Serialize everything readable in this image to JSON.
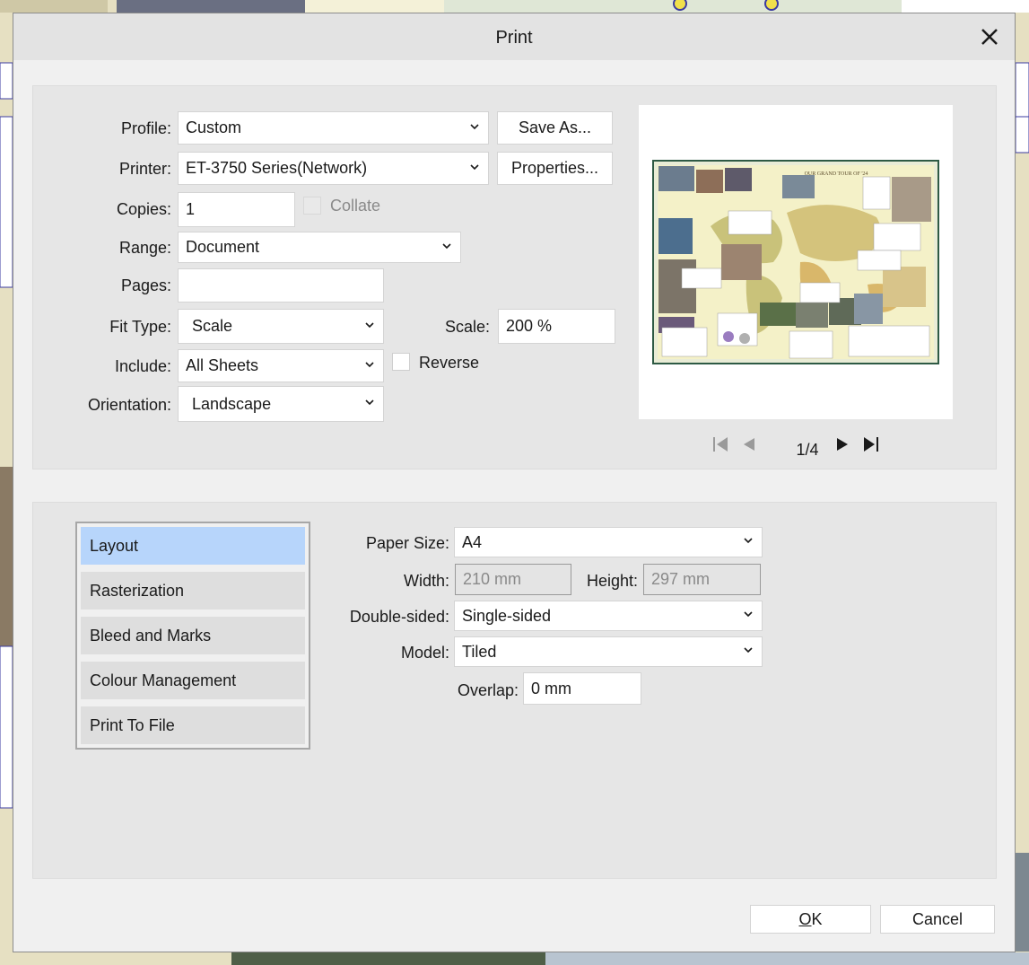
{
  "dialog": {
    "title": "Print"
  },
  "print": {
    "profile": {
      "label": "Profile:",
      "value": "Custom"
    },
    "save_as_label": "Save As...",
    "printer": {
      "label": "Printer:",
      "value": "ET-3750 Series(Network)"
    },
    "properties_label": "Properties...",
    "copies": {
      "label": "Copies:",
      "value": "1"
    },
    "collate": {
      "label": "Collate",
      "checked": false,
      "enabled": false
    },
    "range": {
      "label": "Range:",
      "value": "Document"
    },
    "pages": {
      "label": "Pages:",
      "value": ""
    },
    "fit_type": {
      "label": "Fit Type:",
      "value": "Scale"
    },
    "scale": {
      "label": "Scale:",
      "value": "200 %"
    },
    "include": {
      "label": "Include:",
      "value": "All Sheets"
    },
    "reverse": {
      "label": "Reverse",
      "checked": false
    },
    "orientation": {
      "label": "Orientation:",
      "value": "Landscape"
    }
  },
  "preview": {
    "poster_title": "OUR GRAND TOUR OF '24",
    "page_indicator": "1/4"
  },
  "tabs": [
    {
      "label": "Layout",
      "active": true
    },
    {
      "label": "Rasterization",
      "active": false
    },
    {
      "label": "Bleed and Marks",
      "active": false
    },
    {
      "label": "Colour Management",
      "active": false
    },
    {
      "label": "Print To File",
      "active": false
    }
  ],
  "layout": {
    "paper_size": {
      "label": "Paper Size:",
      "value": "A4"
    },
    "width": {
      "label": "Width:",
      "value": "210 mm"
    },
    "height": {
      "label": "Height:",
      "value": "297 mm"
    },
    "double_sided": {
      "label": "Double-sided:",
      "value": "Single-sided"
    },
    "model": {
      "label": "Model:",
      "value": "Tiled"
    },
    "overlap": {
      "label": "Overlap:",
      "value": "0 mm"
    }
  },
  "footer": {
    "ok_prefix": "",
    "ok_underlined": "O",
    "ok_suffix": "K",
    "cancel_label": "Cancel"
  },
  "colors": {
    "accent_tab": "#b7d5fb",
    "dialog_bg": "#f0f0f0",
    "panel_bg": "#e6e6e6"
  }
}
